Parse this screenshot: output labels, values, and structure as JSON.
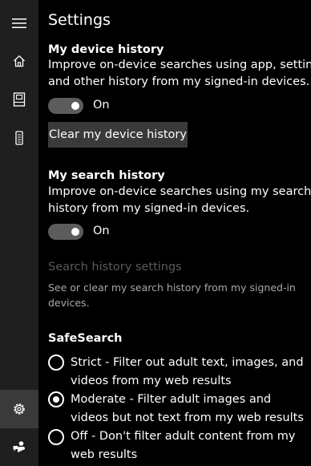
{
  "sidebar": {
    "items": [
      {
        "name": "menu",
        "icon": "hamburger-menu-icon"
      },
      {
        "name": "home",
        "icon": "home-icon"
      },
      {
        "name": "notebook",
        "icon": "notebook-icon"
      },
      {
        "name": "devices",
        "icon": "device-icon"
      },
      {
        "name": "settings",
        "icon": "gear-icon",
        "active": true
      },
      {
        "name": "feedback",
        "icon": "feedback-icon"
      }
    ]
  },
  "page": {
    "title": "Settings"
  },
  "device_history": {
    "title": "My device history",
    "desc_line1": "Improve on-device searches using app, settings",
    "desc_line2": "and other history from my signed-in devices.",
    "toggle_state": "On",
    "clear_button": "Clear my device history"
  },
  "search_history": {
    "title": "My search history",
    "desc_line1": "Improve on-device searches using my search",
    "desc_line2": "history from my signed-in devices.",
    "toggle_state": "On",
    "settings_link": "Search history settings",
    "small_line1": "See or clear my search history from my signed-in",
    "small_line2": "devices."
  },
  "safesearch": {
    "title": "SafeSearch",
    "options": [
      {
        "label": "Strict - Filter out adult text, images, and videos from my web results",
        "selected": false
      },
      {
        "label": "Moderate - Filter adult images and videos but not text from my web results",
        "selected": true
      },
      {
        "label": "Off - Don't filter adult content from my web results",
        "selected": false
      }
    ]
  },
  "colors": {
    "background": "#000000",
    "rail": "#1f1f1f",
    "rail_active": "#3a3a3a",
    "toggle_track": "#5c5c5c",
    "button": "#3a3a3a",
    "disabled_text": "#5a5a5a",
    "secondary_text": "#a8a8a8"
  }
}
